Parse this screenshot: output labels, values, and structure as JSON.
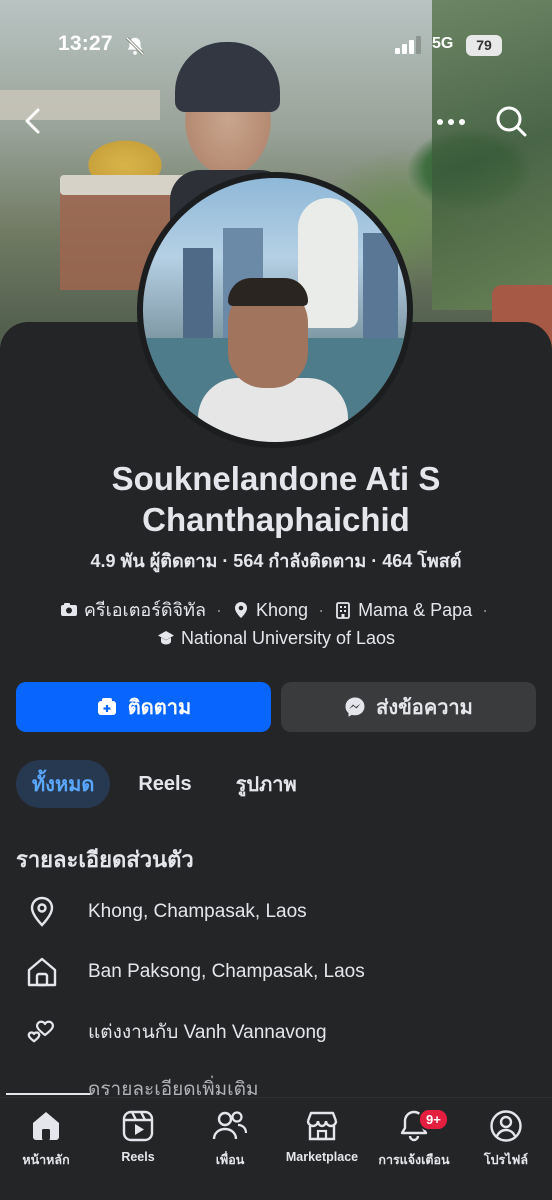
{
  "status_bar": {
    "time": "13:27",
    "network": "5G",
    "battery": "79"
  },
  "profile": {
    "name_line1": "Souknelandone Ati S",
    "name_line2": "Chanthaphaichid",
    "stats": "4.9 พัน ผู้ติดตาม · 564 กำลังติดตาม · 464 โพสต์",
    "meta": {
      "category": "ครีเอเตอร์ดิจิทัล",
      "location": "Khong",
      "workplace": "Mama & Papa",
      "education": "National University of Laos"
    }
  },
  "actions": {
    "follow_label": "ติดตาม",
    "message_label": "ส่งข้อความ"
  },
  "tabs": [
    {
      "label": "ทั้งหมด",
      "active": true
    },
    {
      "label": "Reels",
      "active": false
    },
    {
      "label": "รูปภาพ",
      "active": false
    }
  ],
  "details": {
    "title": "รายละเอียดส่วนตัว",
    "items": [
      {
        "icon": "location-pin-icon",
        "text": "Khong, Champasak, Laos"
      },
      {
        "icon": "home-icon",
        "text": "Ban Paksong, Champasak, Laos"
      },
      {
        "icon": "hearts-icon",
        "text": "แต่งงานกับ Vanh Vannavong"
      }
    ],
    "see_more": "ดรายละเอียดเพิ่มเติม"
  },
  "bottom_nav": {
    "items": [
      {
        "icon": "home-icon",
        "label": "หน้าหลัก",
        "active": true
      },
      {
        "icon": "reels-icon",
        "label": "Reels"
      },
      {
        "icon": "friends-icon",
        "label": "เพื่อน"
      },
      {
        "icon": "marketplace-icon",
        "label": "Marketplace"
      },
      {
        "icon": "bell-icon",
        "label": "การแจ้งเตือน",
        "badge": "9+"
      },
      {
        "icon": "profile-icon",
        "label": "โปรไฟล์"
      }
    ]
  },
  "colors": {
    "accent": "#0866ff",
    "background": "#242526",
    "badge": "#e41e3f",
    "active_tab_text": "#5aa7ff"
  }
}
